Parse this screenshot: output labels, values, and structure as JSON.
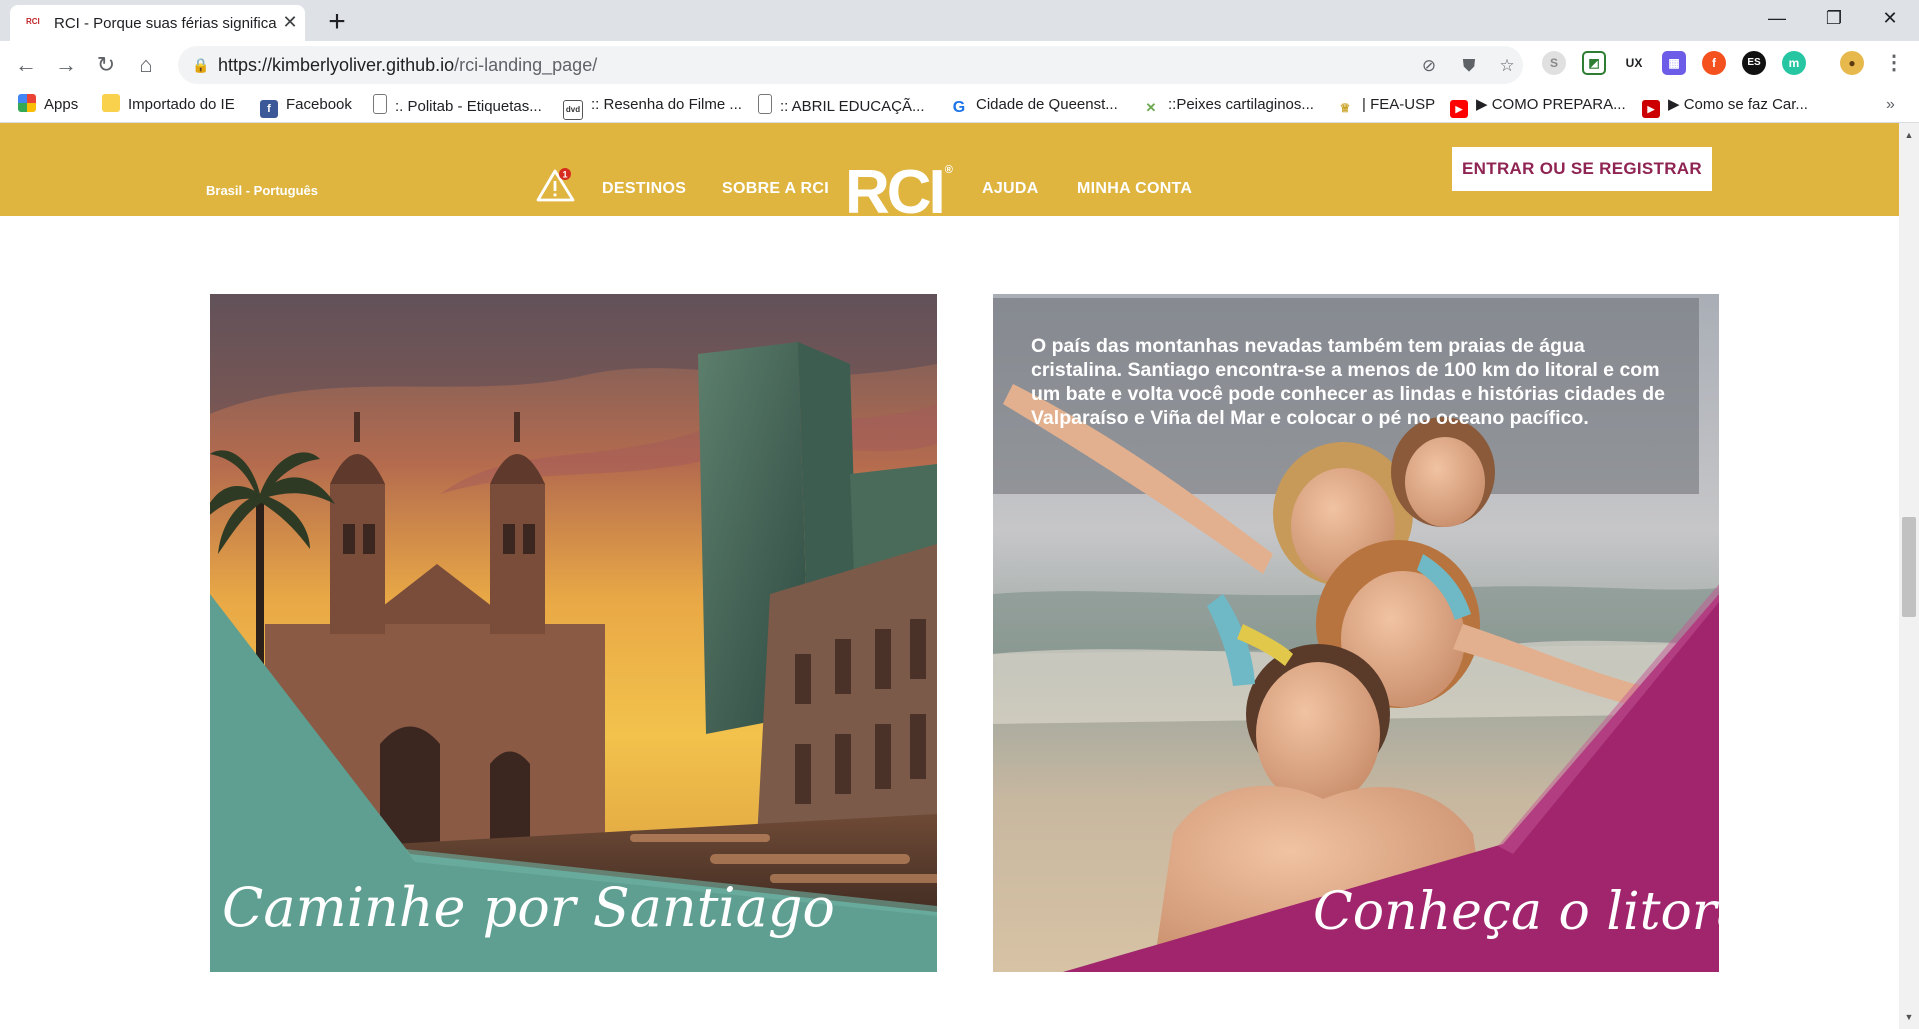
{
  "browser": {
    "tab_title": "RCI - Porque suas férias significa",
    "tab_favicon_text": "RCI",
    "new_tab": "+",
    "close_tab": "✕",
    "url_host": "https://kimberlyoliver.github.io",
    "url_path": "/rci-landing_page/",
    "window_controls": {
      "minimize": "—",
      "restore": "❐",
      "close": "✕"
    },
    "extensions": [
      "S",
      "◩",
      "UX",
      "▦",
      "f",
      "ES",
      "m"
    ],
    "more_icon": "⋮"
  },
  "bookmarks": [
    {
      "label": "Apps",
      "icon": "apps-grid-icon"
    },
    {
      "label": "Importado do IE",
      "icon": "folder-icon"
    },
    {
      "label": "Facebook",
      "icon": "facebook-icon"
    },
    {
      "label": ":. Politab - Etiquetas...",
      "icon": "page-icon"
    },
    {
      "label": ":: Resenha do Filme ...",
      "icon": "page-icon"
    },
    {
      "label": ":: ABRIL EDUCAÇÃ...",
      "icon": "page-icon"
    },
    {
      "label": "Cidade de Queenst...",
      "icon": "google-icon"
    },
    {
      "label": "::Peixes cartilaginos...",
      "icon": "fish-icon"
    },
    {
      "label": "| FEA-USP",
      "icon": "fea-icon"
    },
    {
      "label": "▶ COMO PREPARA...",
      "icon": "youtube-icon"
    },
    {
      "label": "▶ Como se faz Car...",
      "icon": "youtube-icon"
    }
  ],
  "bookmarks_more": "»",
  "header": {
    "locale": "Brasil - Português",
    "alert_count": "1",
    "nav": [
      "DESTINOS",
      "SOBRE A RCI",
      "AJUDA",
      "MINHA CONTA"
    ],
    "logo": "RCI",
    "logo_mark": "®",
    "login_button": "ENTRAR OU SE REGISTRAR",
    "colors": {
      "header_bg": "#dfb540",
      "login_text": "#8f2352"
    }
  },
  "cards": [
    {
      "caption": "Caminhe por Santiago",
      "image": "santiago-cathedral-sunset-photo",
      "accent": "#5e9f91"
    },
    {
      "caption": "Conheça o litoral do Pacífico",
      "text": "O país das montanhas nevadas também tem praias de água cristalina. Santiago encontra-se a menos de 100 km do litoral e com um bate e volta você pode conhecer as lindas e histórias cidades de Valparaíso e Viña del Mar e colocar o pé no oceano pacífico.",
      "image": "family-beach-photo",
      "accent": "#a0256d"
    }
  ]
}
